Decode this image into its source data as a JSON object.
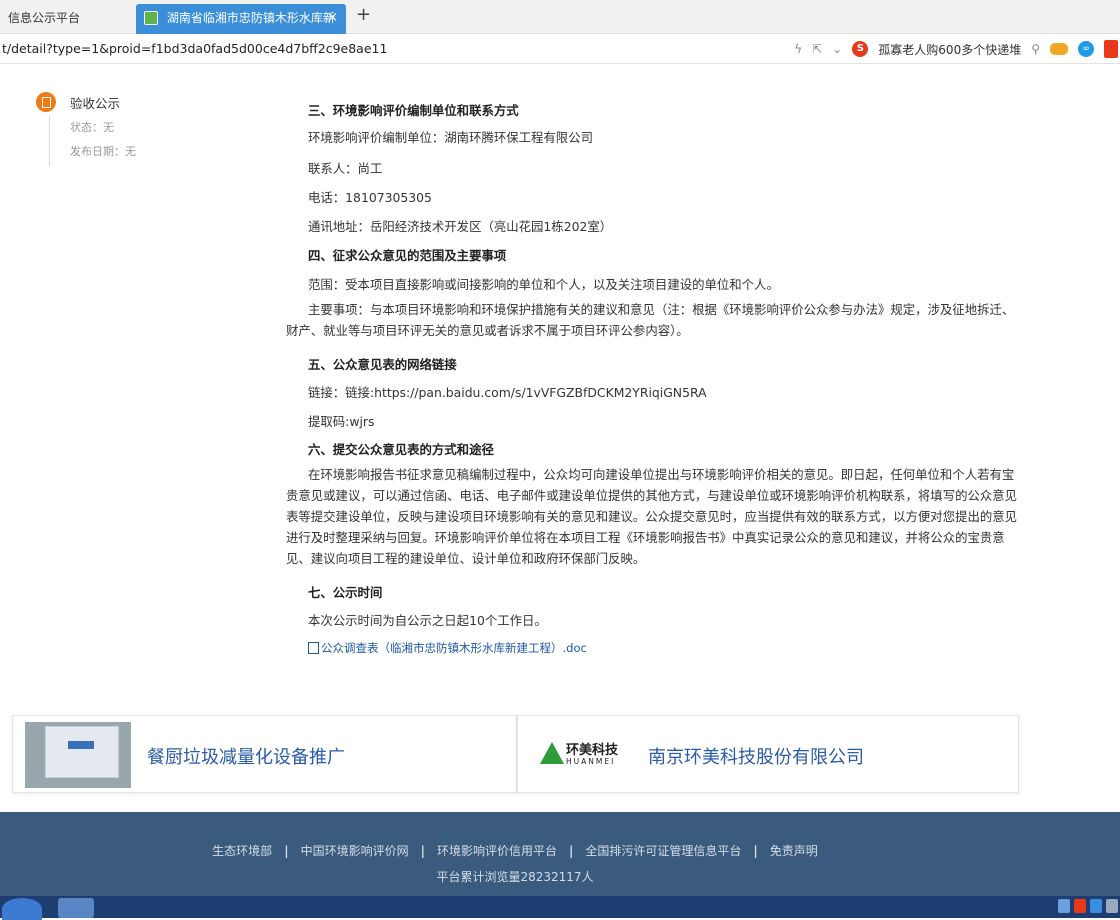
{
  "browser": {
    "tabs": [
      {
        "label": "信息公示平台"
      },
      {
        "label": "湖南省临湘市忠防镇木形水库新建工"
      }
    ],
    "tab_close": "×",
    "new_tab": "+",
    "url": "t/detail?type=1&proid=f1bd3da0fad5d00ce4d7bff2c9e8ae11",
    "addr_icons": [
      "lightning-icon",
      "share-icon",
      "dropdown-icon"
    ],
    "search_hint": "孤寡老人购600多个快递堆",
    "search_icon": "search-icon"
  },
  "sidebar": {
    "title": "验收公示",
    "status": "状态：无",
    "date": "发布日期：无"
  },
  "content": {
    "sec3_heading": "三、环境影响评价编制单位和联系方式",
    "sec3_unit": "环境影响评价编制单位：湖南环腾环保工程有限公司",
    "sec3_contact": "联系人：尚工",
    "sec3_phone": "电话：18107305305",
    "sec3_address": "通讯地址：岳阳经济技术开发区（亮山花园1栋202室）",
    "sec4_heading": "四、征求公众意见的范围及主要事项",
    "sec4_scope": "范围：受本项目直接影响或间接影响的单位和个人，以及关注项目建设的单位和个人。",
    "sec4_items": "主要事项：与本项目环境影响和环境保护措施有关的建议和意见（注：根据《环境影响评价公众参与办法》规定，涉及征地拆迁、财产、就业等与项目环评无关的意见或者诉求不属于项目环评公参内容）。",
    "sec5_heading": "五、公众意见表的网络链接",
    "sec5_link": "链接：链接:https://pan.baidu.com/s/1vVFGZBfDCKM2YRiqiGN5RA",
    "sec5_code": "提取码:wjrs",
    "sec6_heading": "六、提交公众意见表的方式和途径",
    "sec6_body": "在环境影响报告书征求意见稿编制过程中，公众均可向建设单位提出与环境影响评价相关的意见。即日起，任何单位和个人若有宝贵意见或建议，可以通过信函、电话、电子邮件或建设单位提供的其他方式，与建设单位或环境影响评价机构联系，将填写的公众意见表等提交建设单位，反映与建设项目环境影响有关的意见和建议。公众提交意见时，应当提供有效的联系方式，以方便对您提出的意见进行及时整理采纳与回复。环境影响评价单位将在本项目工程《环境影响报告书》中真实记录公众的意见和建议，并将公众的宝贵意见、建议向项目工程的建设单位、设计单位和政府环保部门反映。",
    "sec7_heading": "七、公示时间",
    "sec7_body": "本次公示时间为自公示之日起10个工作日。",
    "attachment": "公众调查表（临湘市忠防镇木形水库新建工程）.doc"
  },
  "ads": [
    {
      "text": "餐厨垃圾减量化设备推广"
    },
    {
      "brand": "环美科技",
      "brand_sub": "HUANMEI",
      "text": "南京环美科技股份有限公司"
    }
  ],
  "footer": {
    "links": [
      "生态环境部",
      "中国环境影响评价网",
      "环境影响评价信用平台",
      "全国排污许可证管理信息平台",
      "免责声明"
    ],
    "separator": "|",
    "visits": "平台累计浏览量28232117人"
  },
  "colors": {
    "tab_active": "#3b8fd8",
    "link": "#1c57a8",
    "ad_text": "#2b5aa8",
    "footer_bg": "#3b5b7e",
    "status_dot": "#f07b14"
  }
}
